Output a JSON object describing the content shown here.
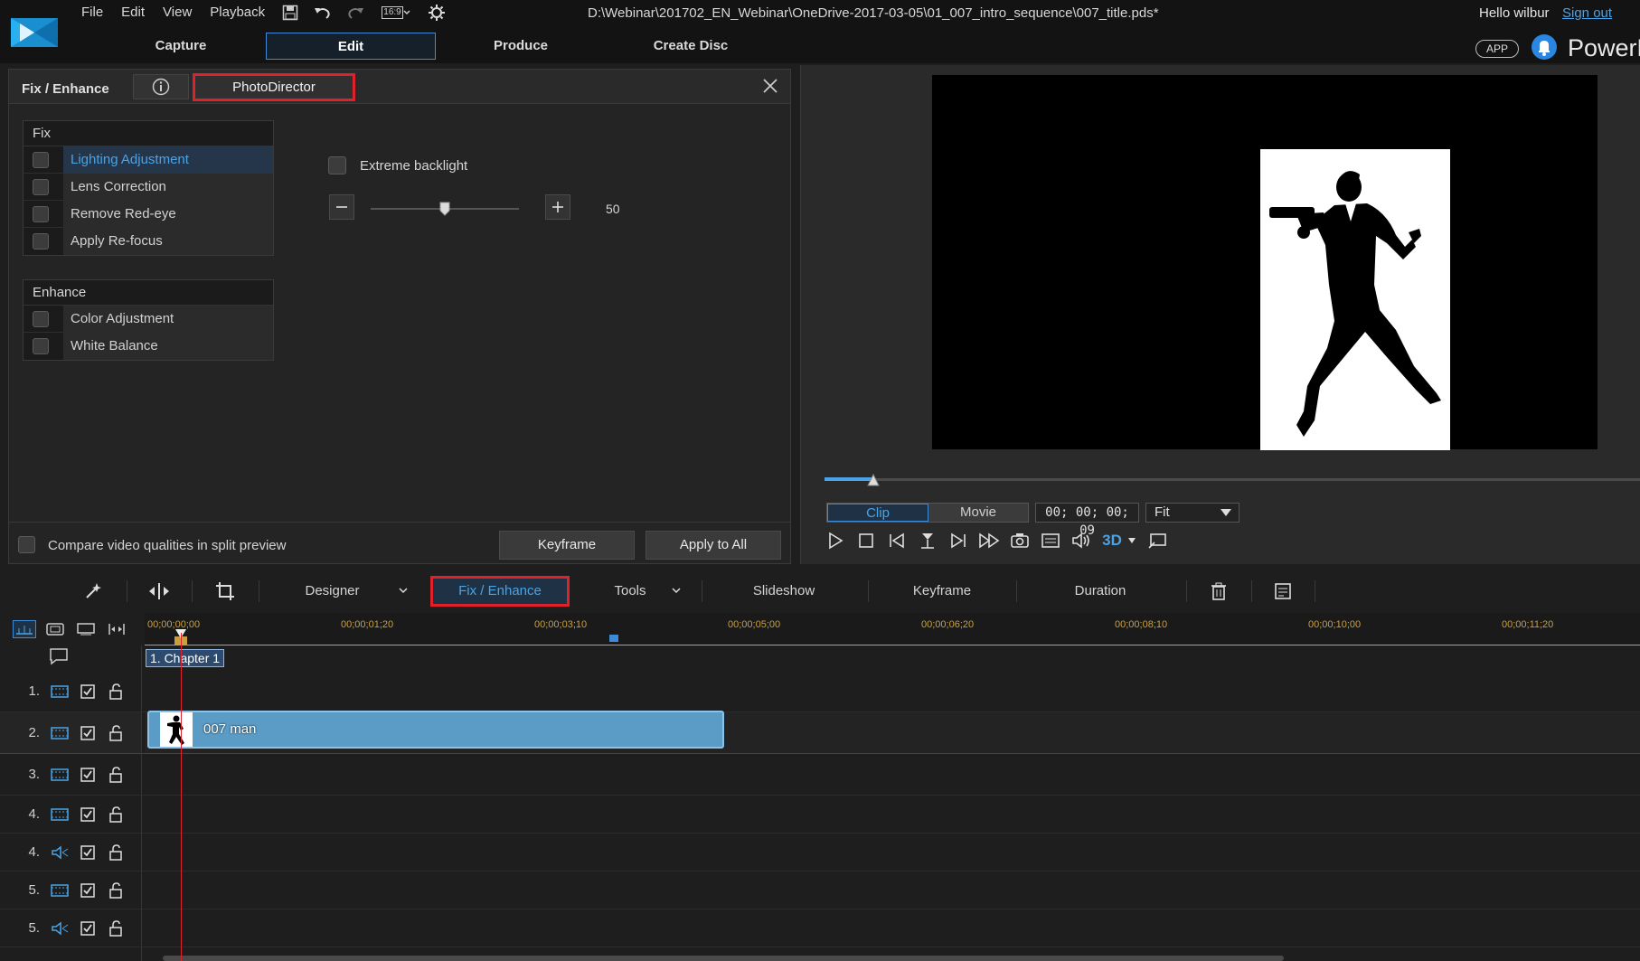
{
  "menu": [
    "File",
    "Edit",
    "View",
    "Playback"
  ],
  "aspect_ratio": "16:9",
  "file_path": "D:\\Webinar\\201702_EN_Webinar\\OneDrive-2017-03-05\\01_007_intro_sequence\\007_title.pds*",
  "user": {
    "greeting": "Hello wilbur",
    "sign_out": "Sign out"
  },
  "modes": [
    "Capture",
    "Edit",
    "Produce",
    "Create Disc"
  ],
  "app_badge": "APP",
  "brand": "PowerD",
  "fix_panel": {
    "title": "Fix / Enhance",
    "photodirector": "PhotoDirector",
    "fix_group": {
      "title": "Fix",
      "items": [
        "Lighting Adjustment",
        "Lens Correction",
        "Remove Red-eye",
        "Apply Re-focus"
      ],
      "selected": "Lighting Adjustment"
    },
    "enhance_group": {
      "title": "Enhance",
      "items": [
        "Color Adjustment",
        "White Balance"
      ]
    },
    "extreme_backlight": "Extreme backlight",
    "slider_value": "50",
    "slider_fraction": 0.5,
    "compare_label": "Compare video qualities in split preview",
    "keyframe_btn": "Keyframe",
    "apply_all_btn": "Apply to All"
  },
  "preview": {
    "clip_btn": "Clip",
    "movie_btn": "Movie",
    "timecode": "00; 00; 00; 09",
    "fit": "Fit",
    "scrub_fraction": 0.06,
    "three_d": "3D"
  },
  "toolbar": {
    "designer": "Designer",
    "fix_enhance": "Fix / Enhance",
    "tools": "Tools",
    "slideshow": "Slideshow",
    "keyframe": "Keyframe",
    "duration": "Duration"
  },
  "timeline": {
    "ruler_labels": [
      "00;00;00;00",
      "00;00;01;20",
      "00;00;03;10",
      "00;00;05;00",
      "00;00;06;20",
      "00;00;08;10",
      "00;00;10;00",
      "00;00;11;20"
    ],
    "chapter": "1. Chapter 1",
    "tracks": [
      {
        "num": "1.",
        "type": "video"
      },
      {
        "num": "2.",
        "type": "video"
      },
      {
        "num": "3.",
        "type": "video"
      },
      {
        "num": "4.",
        "type": "video"
      },
      {
        "num": "4.",
        "type": "audio"
      },
      {
        "num": "5.",
        "type": "video"
      },
      {
        "num": "5.",
        "type": "audio"
      }
    ],
    "clip_label": "007 man"
  },
  "colors": {
    "accent": "#4aa3e6",
    "highlight": "#e0202a",
    "clip": "#5a9cc6"
  }
}
